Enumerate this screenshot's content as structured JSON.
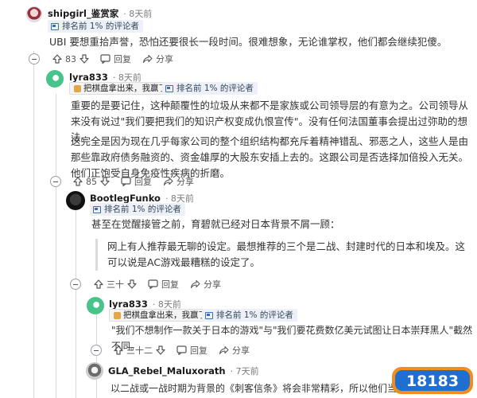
{
  "comments": [
    {
      "username": "shipgirl_鉴赏家",
      "time": "· 8天前",
      "flair": "排名前 1% 的评论者",
      "body": "UBI 要想重拾声誉，恐怕还要很长一段时间。很难想象，无论谁掌权，他们都会继续犯傻。",
      "votes": "83",
      "reply_label": "回复",
      "share_label": "分享"
    },
    {
      "username": "lyra833",
      "time": "· 8天前",
      "user_flair": "把棋盘拿出来，我赢了！",
      "flair": "排名前 1% 的评论者",
      "paragraphs": [
        "重要的是要记住，这种颠覆性的垃圾从来都不是家族或公司领导层的有意为之。公司领导从来没有说过\"我们要把我们的知识产权变成仇恨宣传\"。没有任何法国董事会提出过弥助的想法。",
        "这完全是因为现在几乎每家公司的整个组织结构都充斥着精神错乱、邪恶之人，这些人是由那些靠政府债务融资的、资金雄厚的大股东安插上去的。这跟公司是否选择加倍投入无关。他们正饱受自身免疫性疾病的折磨。"
      ],
      "votes": "85",
      "reply_label": "回复",
      "share_label": "分享"
    },
    {
      "username": "BootlegFunko",
      "time": "· 8天前",
      "flair": "排名前 1% 的评论者",
      "body": "甚至在觉醒接管之前，育碧就已经对日本背景不屑一顾：",
      "quote": "网上有人推荐最无聊的设定。最想推荐的三个是二战、封建时代的日本和埃及。这可以说是AC游戏最糟糕的设定了。",
      "votes": "三十",
      "reply_label": "回复",
      "share_label": "分享"
    },
    {
      "username": "lyra833",
      "time": "· 8天前",
      "user_flair": "把棋盘拿出来，我赢了！",
      "flair": "排名前 1% 的评论者",
      "body": "\"我们不想制作一款关于日本的游戏\"与\"我们要花费数亿美元试图让日本崇拜黑人\"截然不同。",
      "votes": "三十二",
      "reply_label": "回复",
      "share_label": "分享"
    },
    {
      "username": "GLA_Rebel_Maluxorath",
      "time": "· 7天前",
      "body": "以二战或一战时期为背景的《刺客信条》将会非常精彩，所以他们当然拒绝制作它。"
    }
  ],
  "icons": {
    "upvote": "upvote-arrow-icon",
    "downvote": "downvote-arrow-icon",
    "comment": "comment-bubble-icon",
    "share": "share-arrow-icon",
    "flair": "top-commenter-badge-icon",
    "collapse": "collapse-thread-icon"
  },
  "watermark": "18183",
  "colors": {
    "flair_bg": "#edf1f7",
    "flair_icon": "#3d6fb6",
    "thread_line": "#d7dadc",
    "watermark_orange": "#f28c1a",
    "watermark_blue": "#1f6fd1"
  }
}
